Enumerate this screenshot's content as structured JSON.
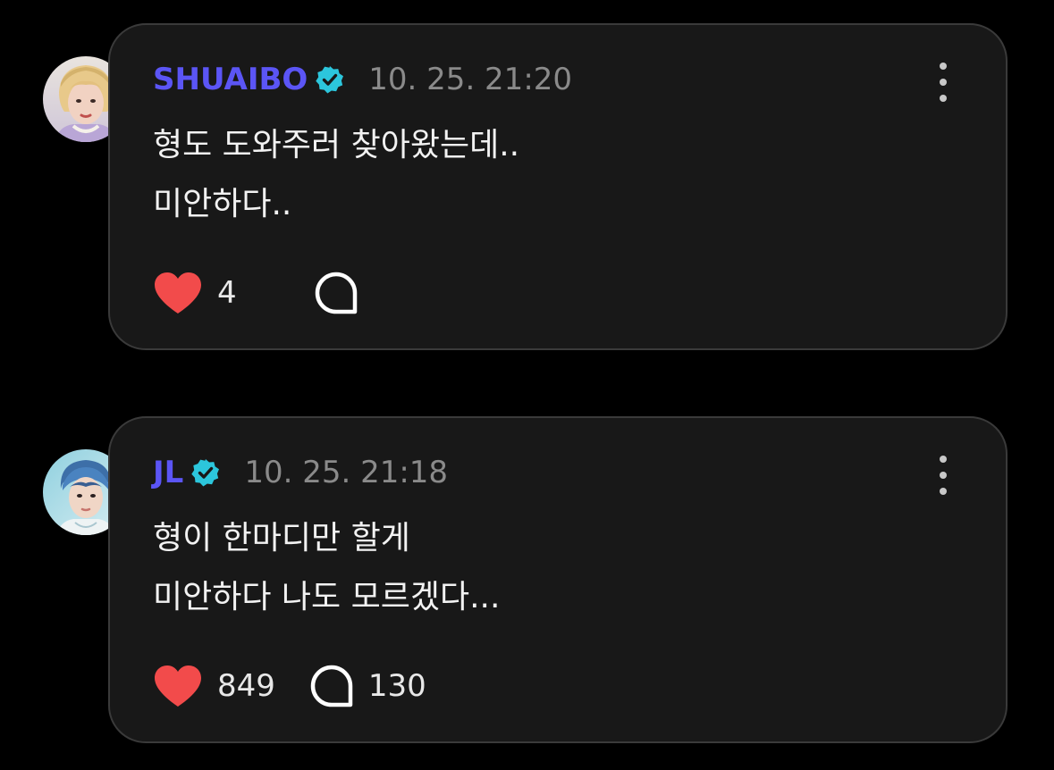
{
  "colors": {
    "background": "#000000",
    "card_background": "#181818",
    "card_border": "#3a3a3a",
    "username": "#5b55f5",
    "verified_badge": "#2cc6dc",
    "timestamp": "#8a8a8a",
    "heart": "#f24b4b",
    "text": "#f2f2f2"
  },
  "icons": {
    "verified": "verified-badge-icon",
    "more": "more-vertical-icon",
    "like": "heart-icon",
    "comment": "comment-bubble-icon"
  },
  "posts": [
    {
      "username": "SHUAIBO",
      "timestamp": "10. 25. 21:20",
      "lines": [
        "형도 도와주러 찾아왔는데..",
        "미안하다.."
      ],
      "likes": "4",
      "comments": ""
    },
    {
      "username": "JL",
      "timestamp": "10. 25. 21:18",
      "lines": [
        "형이 한마디만 할게",
        "미안하다 나도 모르겠다..."
      ],
      "likes": "849",
      "comments": "130"
    }
  ]
}
